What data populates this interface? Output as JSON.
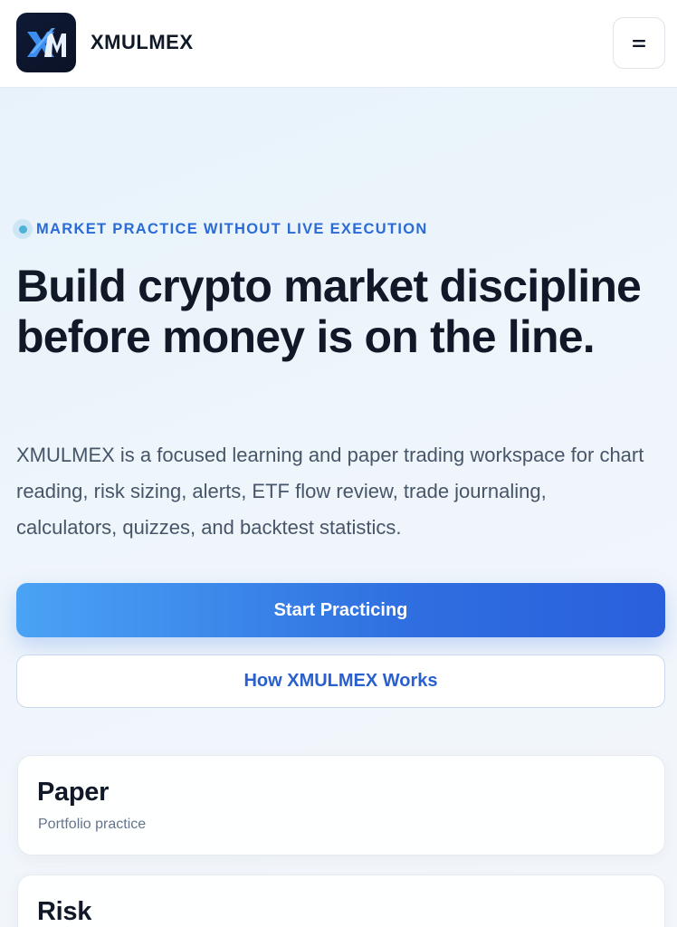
{
  "header": {
    "logo_text": "XM",
    "brand": "XMULMEX",
    "menu_glyph": "="
  },
  "hero": {
    "eyebrow": "MARKET PRACTICE WITHOUT LIVE EXECUTION",
    "headline": "Build crypto market discipline before money is on the line.",
    "lede": "XMULMEX is a focused learning and paper trading workspace for chart reading, risk sizing, alerts, ETF flow review, trade journaling, calculators, quizzes, and backtest statistics."
  },
  "actions": {
    "primary": "Start Practicing",
    "secondary": "How XMULMEX Works"
  },
  "cards": [
    {
      "title": "Paper",
      "subtitle": "Portfolio practice"
    },
    {
      "title": "Risk",
      "subtitle": ""
    }
  ],
  "colors": {
    "accent": "#2f6fe0",
    "eyebrow": "#2a6bd6",
    "dot": "#4fb3d9",
    "logo_bg": "#0f1a35"
  }
}
